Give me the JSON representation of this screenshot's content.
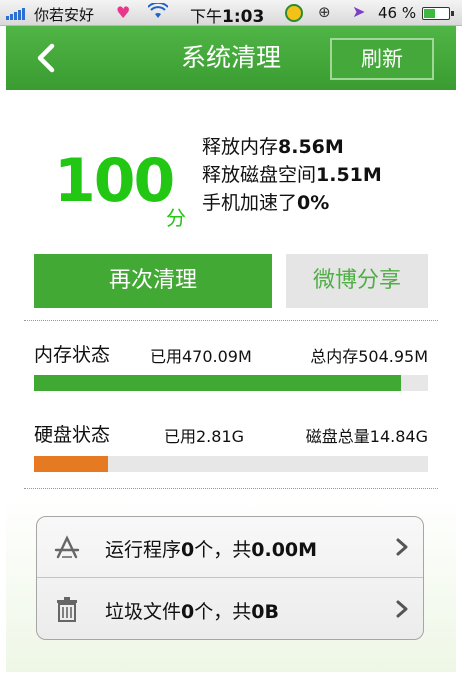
{
  "status_bar": {
    "carrier": "你若安好",
    "time_prefix": "下午",
    "time": "1:03",
    "battery_percent": "46 %",
    "battery_level": 0.46,
    "icons": [
      "signal-icon",
      "heart-icon",
      "wifi-icon",
      "app-360-icon",
      "rotation-lock-icon",
      "location-icon",
      "battery-icon"
    ]
  },
  "header": {
    "title": "系统清理",
    "refresh_label": "刷新",
    "back_icon": "back-arrow-icon"
  },
  "result": {
    "score": "100",
    "score_unit": "分",
    "memory_freed_label": "释放内存",
    "memory_freed_value": "8.56M",
    "disk_freed_label": "释放磁盘空间",
    "disk_freed_value": "1.51M",
    "speedup_label": "手机加速了",
    "speedup_value": "0%"
  },
  "actions": {
    "clean_again_label": "再次清理",
    "share_label": "微博分享"
  },
  "memory": {
    "label": "内存状态",
    "used_label": "已用470.09M",
    "total_label": "总内存504.95M",
    "usage_fraction": 0.931
  },
  "disk": {
    "label": "硬盘状态",
    "used_label": "已用2.81G",
    "total_label": "磁盘总量14.84G",
    "usage_fraction": 0.189
  },
  "list": {
    "items": [
      {
        "icon": "app-store-icon",
        "prefix": "运行程序",
        "count": "0",
        "mid": "个，共",
        "size": "0.00M"
      },
      {
        "icon": "trash-icon",
        "prefix": "垃圾文件",
        "count": "0",
        "mid": "个，共",
        "size": "0B"
      }
    ]
  },
  "colors": {
    "header_green": "#43a935",
    "score_green": "#22c714",
    "memory_bar": "#3fa934",
    "disk_bar": "#e57a23"
  }
}
